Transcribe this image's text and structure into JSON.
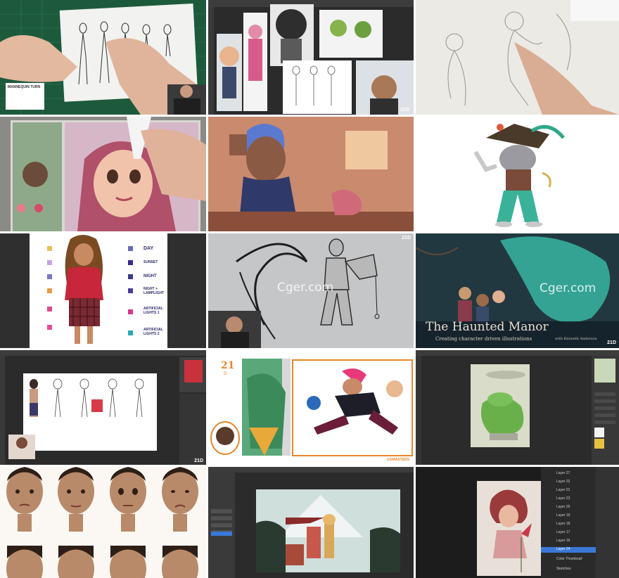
{
  "collage": {
    "tiles": [
      {
        "id": "t1",
        "caption": "MANNEQUIN TURN"
      },
      {
        "id": "t2",
        "badge": "21D"
      },
      {
        "id": "t3"
      },
      {
        "id": "t4"
      },
      {
        "id": "t5"
      },
      {
        "id": "t6"
      },
      {
        "id": "t7",
        "labels": [
          "DAY",
          "SUNSET",
          "NIGHT",
          "NIGHT + LAMPLIGHT",
          "ARTIFICIAL LIGHTS 1",
          "ARTIFICIAL LIGHTS 2"
        ]
      },
      {
        "id": "t8",
        "badge": "21D",
        "watermark": "Cger.com"
      },
      {
        "id": "t9",
        "watermark": "Cger.com",
        "title": "The Haunted Manor",
        "subtitle": "Creating character driven illustrations",
        "byline": "with Kenneth Anderson",
        "badge": "21D"
      },
      {
        "id": "t10",
        "badge": "21D"
      },
      {
        "id": "t11",
        "logo": "21",
        "sublogo": "D",
        "brand": "CGMASTERS"
      },
      {
        "id": "t12"
      },
      {
        "id": "t13"
      },
      {
        "id": "t14"
      },
      {
        "id": "t15",
        "layers": [
          "Layer 27",
          "Layer 22",
          "Layer 21",
          "Layer 23",
          "Layer 20",
          "Layer 19",
          "Layer 18",
          "Layer 17",
          "Layer 16",
          "Layer 24",
          "Color Thumbnail",
          "Sketches"
        ]
      }
    ]
  },
  "colors": {
    "accent": "#e8872a",
    "selected_layer": "#3a78d8",
    "ps_dark": "#2b2b2b",
    "mat_green": "#1d5a3c"
  }
}
